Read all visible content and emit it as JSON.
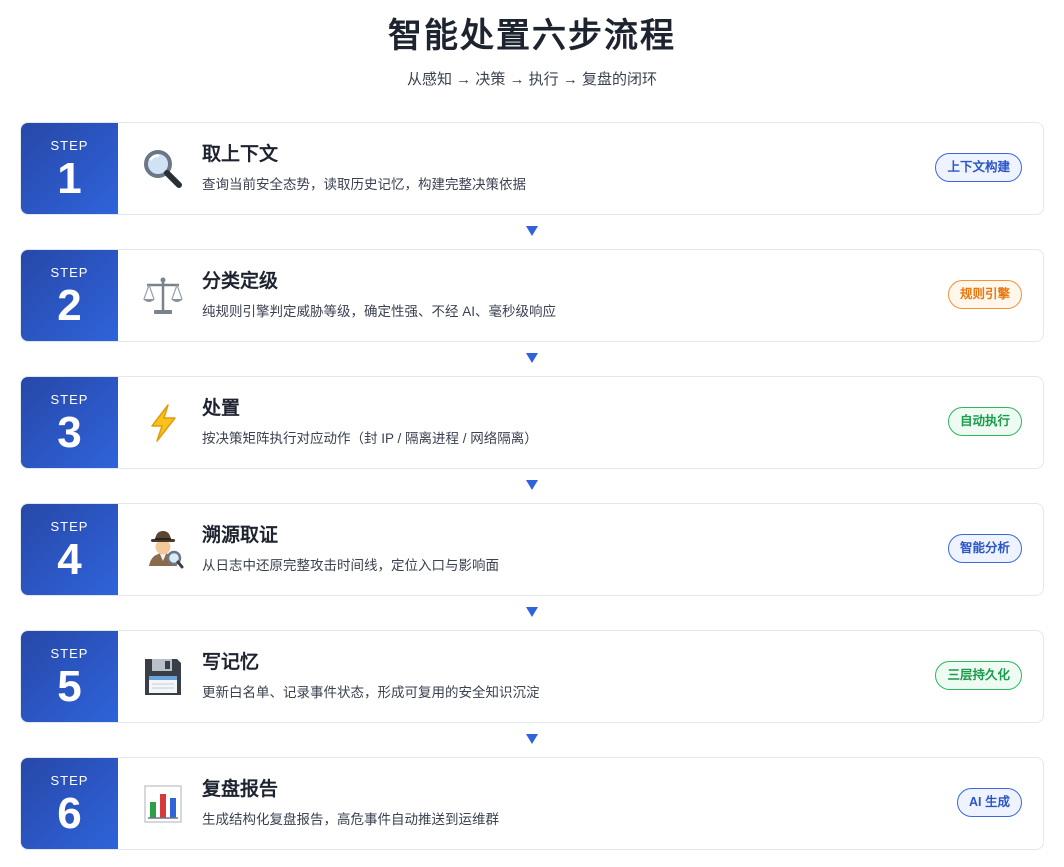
{
  "header": {
    "title": "智能处置六步流程",
    "subtitle": "从感知 → 决策 → 执行 → 复盘的闭环"
  },
  "colors": {
    "step_gradient_start": "#2748a8",
    "step_gradient_end": "#2f63db",
    "arrow": "#2f63db",
    "badge_blue": "#2a56c6",
    "badge_orange": "#e8780f",
    "badge_green": "#1a9c4b"
  },
  "steps": [
    {
      "label": "STEP",
      "number": "1",
      "icon": "magnifier-icon",
      "title": "取上下文",
      "desc": "查询当前安全态势，读取历史记忆，构建完整决策依据",
      "badge": "上下文构建",
      "badge_color": "blue"
    },
    {
      "label": "STEP",
      "number": "2",
      "icon": "balance-scale-icon",
      "title": "分类定级",
      "desc": "纯规则引擎判定威胁等级，确定性强、不经 AI、毫秒级响应",
      "badge": "规则引擎",
      "badge_color": "orange"
    },
    {
      "label": "STEP",
      "number": "3",
      "icon": "lightning-icon",
      "title": "处置",
      "desc": "按决策矩阵执行对应动作（封 IP / 隔离进程 / 网络隔离）",
      "badge": "自动执行",
      "badge_color": "green"
    },
    {
      "label": "STEP",
      "number": "4",
      "icon": "detective-icon",
      "title": "溯源取证",
      "desc": "从日志中还原完整攻击时间线，定位入口与影响面",
      "badge": "智能分析",
      "badge_color": "blue"
    },
    {
      "label": "STEP",
      "number": "5",
      "icon": "floppy-disk-icon",
      "title": "写记忆",
      "desc": "更新白名单、记录事件状态，形成可复用的安全知识沉淀",
      "badge": "三层持久化",
      "badge_color": "green"
    },
    {
      "label": "STEP",
      "number": "6",
      "icon": "bar-chart-icon",
      "title": "复盘报告",
      "desc": "生成结构化复盘报告，高危事件自动推送到运维群",
      "badge": "AI 生成",
      "badge_color": "blue"
    }
  ]
}
